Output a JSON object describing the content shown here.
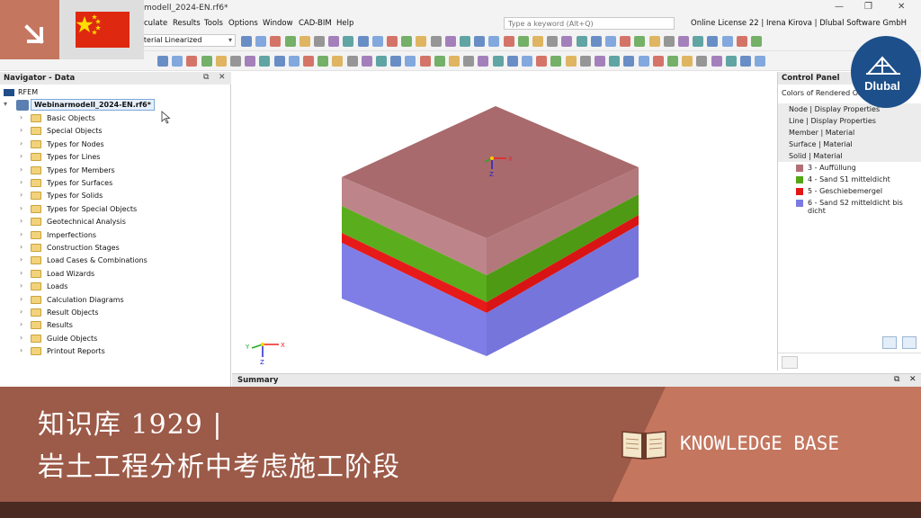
{
  "window": {
    "doc_title": "modell_2024-EN.rf6*",
    "minimize": "—",
    "maximize": "❐",
    "close": "✕"
  },
  "menu": {
    "items": [
      "culate",
      "Results",
      "Tools",
      "Options",
      "Window",
      "CAD-BIM",
      "Help"
    ],
    "search_placeholder": "Type a keyword (Alt+Q)",
    "license": "Online License 22 | Irena Kirova | Dlubal Software GmbH"
  },
  "toolbar": {
    "combo_value": "aterial Linearized"
  },
  "navigator": {
    "title": "Navigator - Data",
    "restore": "⧉",
    "close": "✕",
    "root": "RFEM",
    "model": "Webinarmodell_2024-EN.rf6*",
    "items": [
      "Basic Objects",
      "Special Objects",
      "Types for Nodes",
      "Types for Lines",
      "Types for Members",
      "Types for Surfaces",
      "Types for Solids",
      "Types for Special Objects",
      "Geotechnical Analysis",
      "Imperfections",
      "Construction Stages",
      "Load Cases & Combinations",
      "Load Wizards",
      "Loads",
      "Calculation Diagrams",
      "Result Objects",
      "Results",
      "Guide Objects",
      "Printout Reports"
    ]
  },
  "viewport": {
    "axis_x": "X",
    "axis_y": "Y",
    "axis_z": "Z"
  },
  "summary": {
    "title": "Summary",
    "restore": "⧉",
    "close": "✕"
  },
  "control_panel": {
    "title": "Control Panel",
    "subtitle": "Colors of Rendered Obj",
    "sections": [
      "Node | Display Properties",
      "Line | Display Properties",
      "Member | Material",
      "Surface | Material",
      "Solid | Material"
    ],
    "materials": [
      {
        "label": "3 - Auffüllung",
        "color": "#b26f74"
      },
      {
        "label": "4 - Sand S1 mitteldicht",
        "color": "#55a617"
      },
      {
        "label": "5 - Geschiebemergel",
        "color": "#e21617"
      },
      {
        "label": "6 - Sand S2 mitteldicht bis dicht",
        "color": "#7b7ae3"
      }
    ]
  },
  "logo": {
    "text": "Dlubal"
  },
  "banner": {
    "title_line1": "知识库 1929 |",
    "title_line2": "岩土工程分析中考虑施工阶段",
    "knowledge_base": "KNOWLEDGE BASE"
  },
  "colors": {
    "banner": "#9c5a48",
    "banner_right": "#c4765f",
    "footer": "#4a2a21",
    "logo": "#1d4f8a",
    "layer_fill_top": "#a86a6c",
    "layer_fill_front": "#b87c7e"
  }
}
